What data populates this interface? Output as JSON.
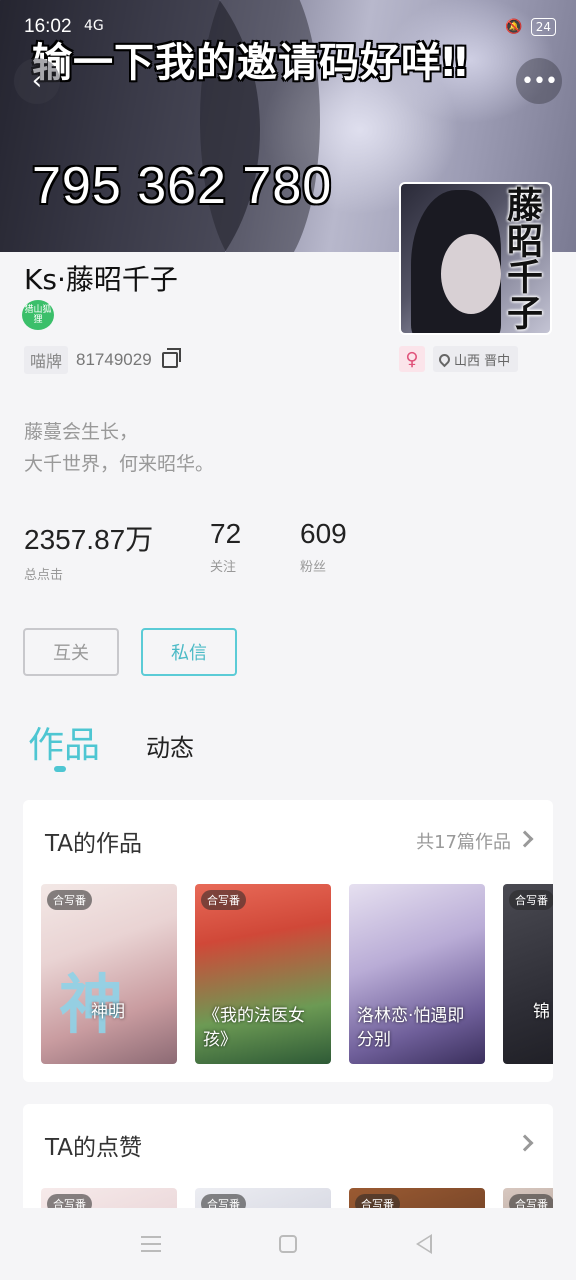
{
  "status_bar": {
    "time": "16:02",
    "signal": "4G",
    "battery": "24"
  },
  "banner": {
    "title": "输一下我的邀请码好咩‼",
    "code": "795 362 780"
  },
  "header": {
    "back_icon": "chevron-left-icon",
    "more_icon": "more-dots-icon",
    "more_label": "•••"
  },
  "avatar": {
    "overlay_text": "藤昭千子"
  },
  "profile": {
    "username": "Ks·藤昭千子",
    "badge": "猎山狐狸",
    "id_label": "喵牌",
    "id_value": "81749029",
    "gender": "♀",
    "location": "山西 晋中",
    "bio_line1": "藤蔓会生长，",
    "bio_line2": "大千世界，何来昭华。"
  },
  "stats": [
    {
      "value": "2357.87万",
      "label": "总点击"
    },
    {
      "value": "72",
      "label": "关注"
    },
    {
      "value": "609",
      "label": "粉丝"
    }
  ],
  "actions": {
    "mutual_label": "互关",
    "message_label": "私信"
  },
  "tabs": {
    "active": "作品",
    "other": "动态"
  },
  "works": {
    "title": "TA的作品",
    "count": "共17篇作品",
    "items": [
      {
        "tag": "合写番",
        "title": "神明"
      },
      {
        "tag": "合写番",
        "title": "《我的法医女孩》"
      },
      {
        "tag": "",
        "title": "洛林恋·怕遇即分别"
      },
      {
        "tag": "合写番",
        "title": "锦"
      }
    ]
  },
  "likes": {
    "title": "TA的点赞",
    "items": [
      {
        "tag": "合写番"
      },
      {
        "tag": "合写番"
      },
      {
        "tag": "合写番"
      },
      {
        "tag": "合写番"
      }
    ]
  },
  "colors": {
    "accent": "#4ec6d2",
    "female": "#e0527a",
    "background": "#f5f5f7"
  }
}
